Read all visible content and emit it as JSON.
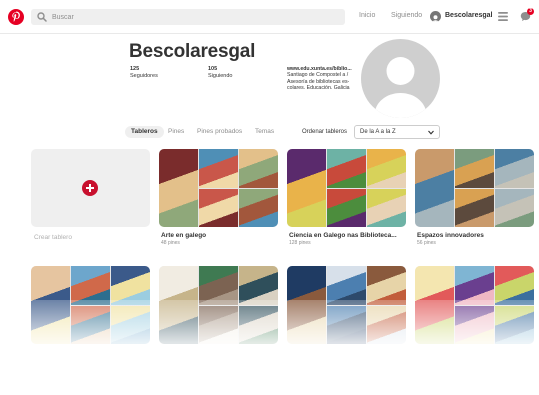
{
  "header": {
    "search_placeholder": "Buscar",
    "nav": [
      "Inicio",
      "Siguiendo"
    ],
    "username": "Bescolaresgal",
    "notification_count": "3",
    "brand_color": "#e60023"
  },
  "profile": {
    "name": "Bescolaresgal",
    "followers_count": "125",
    "followers_label": "Seguidores",
    "following_count": "105",
    "following_label": "Siguiendo",
    "bio_url": "www.edu.xunta.es/biblio...",
    "bio_text": "Santiago de Compostel a / Asesoría de bibliotecas es- colares. Educación. Galicia"
  },
  "tabs": [
    {
      "label": "Tableros",
      "active": true
    },
    {
      "label": "Pines",
      "active": false
    },
    {
      "label": "Pines probados",
      "active": false
    },
    {
      "label": "Temas",
      "active": false
    }
  ],
  "sort": {
    "label": "Ordenar tableros",
    "selected": "De la A a la Z"
  },
  "create_board_label": "Crear tablero",
  "boards": [
    {
      "title": "Arte en galego",
      "pins": "48 pines",
      "colors": [
        "#7a2c2c",
        "#4f8fb6",
        "#e3c08a",
        "#c9574a",
        "#8fa87a",
        "#f0d9a8",
        "#a2573c"
      ]
    },
    {
      "title": "Ciencia en Galego nas Biblioteca...",
      "pins": "128 pines",
      "colors": [
        "#5a2a6c",
        "#6db2a5",
        "#e9b34a",
        "#c84a3b",
        "#d7d25a",
        "#4c8d3d",
        "#e8d2b5"
      ]
    },
    {
      "title": "Espazos innovadores",
      "pins": "56 pines",
      "colors": [
        "#c99a6b",
        "#7b9c7e",
        "#4c7fa3",
        "#d9a152",
        "#a5b6bd",
        "#5c4a3d",
        "#c5c2b7"
      ]
    }
  ],
  "boards_row2": [
    {
      "colors": [
        "#e6c5a0",
        "#6da6cc",
        "#3b5a8a",
        "#d0694a",
        "#f0e2a0",
        "#2d6e8f",
        "#9bcde0"
      ]
    },
    {
      "colors": [
        "#f1ece2",
        "#3f7a52",
        "#c6b48a",
        "#7c6352",
        "#2f4f5b",
        "#a79584",
        "#d9d1c2"
      ]
    },
    {
      "colors": [
        "#1f3b63",
        "#d7e0ea",
        "#8a5a3d",
        "#4c7fb0",
        "#e7d4a8",
        "#2d4a6c",
        "#c25d3b"
      ]
    },
    {
      "colors": [
        "#f4e6b0",
        "#7fb5d3",
        "#e25a5a",
        "#6a3f8f",
        "#c9d56a",
        "#efb7c3",
        "#3b6f9e"
      ]
    }
  ]
}
